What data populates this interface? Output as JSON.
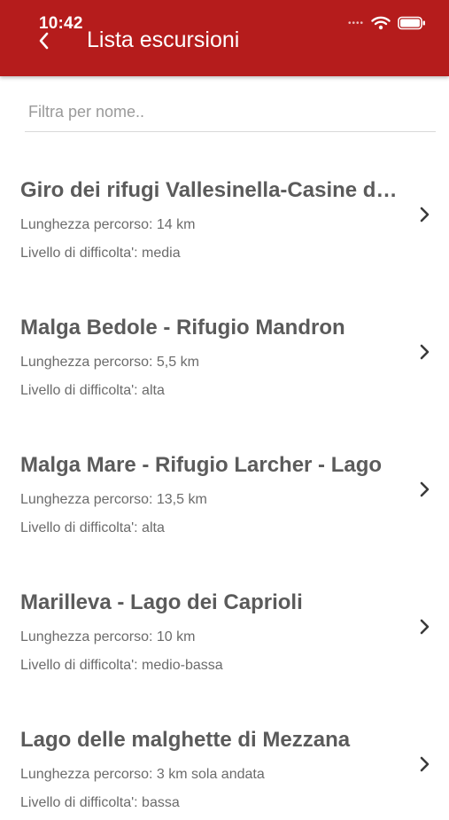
{
  "status_bar": {
    "time": "10:42",
    "signal_icon": "cellular-signal-icon",
    "wifi_icon": "wifi-icon",
    "battery_icon": "battery-icon"
  },
  "header": {
    "back_icon": "chevron-left-icon",
    "title": "Lista escursioni",
    "background_color": "#b51c1c"
  },
  "search": {
    "placeholder": "Filtra per nome..",
    "value": ""
  },
  "list": {
    "chevron_icon": "chevron-right-icon",
    "items": [
      {
        "name": "Giro dei rifugi Vallesinella-Casine di Vallesinella",
        "length": "Lunghezza percorso: 14 km",
        "level": "Livello di difficolta': media"
      },
      {
        "name": "Malga Bedole - Rifugio Mandron",
        "length": "Lunghezza percorso: 5,5 km",
        "level": "Livello di difficolta': alta"
      },
      {
        "name": "Malga Mare - Rifugio Larcher - Lago",
        "length": "Lunghezza percorso: 13,5 km",
        "level": "Livello di difficolta': alta"
      },
      {
        "name": "Marilleva - Lago dei Caprioli",
        "length": "Lunghezza percorso: 10 km",
        "level": "Livello di difficolta': medio-bassa"
      },
      {
        "name": "Lago delle malghette di Mezzana",
        "length": "Lunghezza percorso: 3 km sola andata",
        "level": "Livello di difficolta': bassa"
      }
    ]
  }
}
